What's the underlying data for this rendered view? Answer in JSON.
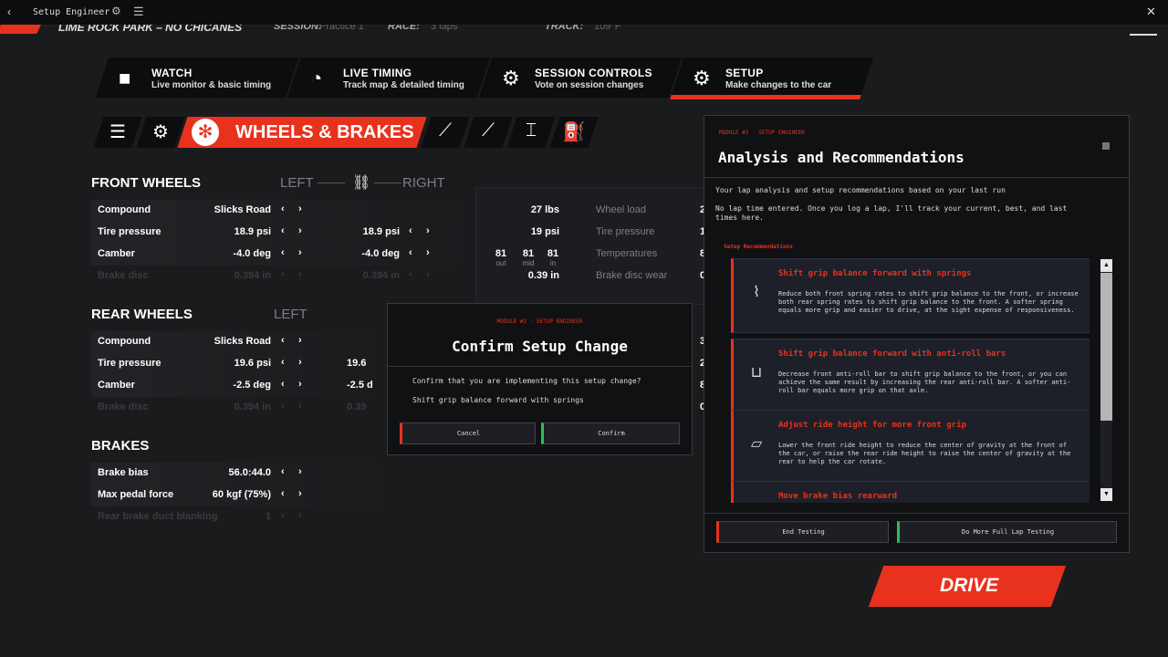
{
  "titlebar": {
    "back": "‹",
    "title": "Setup Engineer",
    "gear": "⚙",
    "menu": "☰",
    "close": "✕"
  },
  "session": {
    "track": "LIME ROCK PARK – NO CHICANES",
    "session_label": "SESSION:",
    "session_value": "Practice 1",
    "race_label": "RACE:",
    "race_value": "3 laps",
    "track_label": "TRACK:",
    "track_value": "109°F"
  },
  "nav": [
    {
      "icon": "■",
      "title": "WATCH",
      "sub": "Live monitor & basic timing"
    },
    {
      "icon": "◔",
      "title": "LIVE TIMING",
      "sub": "Track map & detailed timing"
    },
    {
      "icon": "⚙",
      "title": "SESSION CONTROLS",
      "sub": "Vote on session changes"
    },
    {
      "icon": "⚙",
      "title": "SETUP",
      "sub": "Make changes to the car"
    }
  ],
  "subtabs": {
    "list_icon": "☰",
    "engine_icon": "⚙",
    "active_icon": "✻",
    "active_label": "WHEELS & BRAKES",
    "shock_icon": "⟋",
    "wrench_icon": "⟋",
    "chassis_icon": "⌶",
    "fuel_icon": "⛽"
  },
  "front": {
    "title": "FRONT WHEELS",
    "left": "LEFT",
    "link": "⛓",
    "right": "RIGHT",
    "rows": [
      {
        "label": "Compound",
        "left": "Slicks Road",
        "right": ""
      },
      {
        "label": "Tire pressure",
        "left": "18.9 psi",
        "right": "18.9 psi"
      },
      {
        "label": "Camber",
        "left": "-4.0 deg",
        "right": "-4.0 deg"
      },
      {
        "label": "Brake disc",
        "left": "0.394 in",
        "right": "0.394 in"
      }
    ]
  },
  "rear": {
    "title": "REAR WHEELS",
    "left": "LEFT",
    "rows": [
      {
        "label": "Compound",
        "left": "Slicks Road",
        "right": ""
      },
      {
        "label": "Tire pressure",
        "left": "19.6 psi",
        "right": "19.6"
      },
      {
        "label": "Camber",
        "left": "-2.5 deg",
        "right": "-2.5 d"
      },
      {
        "label": "Brake disc",
        "left": "0.394 in",
        "right": "0.39"
      }
    ]
  },
  "brakes": {
    "title": "BRAKES",
    "rows": [
      {
        "label": "Brake bias",
        "value": "56.0:44.0"
      },
      {
        "label": "Max pedal force",
        "value": "60 kgf (75%)"
      },
      {
        "label": "Rear brake duct blanking",
        "value": "1"
      }
    ]
  },
  "arrows": {
    "left": "‹",
    "right": "›"
  },
  "telemetry": {
    "wheel_load_value": "27 lbs",
    "wheel_load_label": "Wheel load",
    "tire_pressure_value": "19 psi",
    "tire_pressure_label": "Tire pressure",
    "temps": [
      {
        "v": "81",
        "s": "out"
      },
      {
        "v": "81",
        "s": "mid"
      },
      {
        "v": "81",
        "s": "in"
      }
    ],
    "temperatures_label": "Temperatures",
    "disc_wear_value": "0.39 in",
    "disc_wear_label": "Brake disc wear",
    "edge": [
      "2",
      "1",
      "8",
      "0"
    ],
    "edge_rear": [
      "3",
      "2",
      "8",
      "0"
    ]
  },
  "confirm": {
    "crumb": "MODULE #2  ·  SETUP ENGINEER",
    "title": "Confirm Setup Change",
    "body": "Confirm that you are implementing this setup change?",
    "change": "Shift grip balance forward with springs",
    "cancel": "Cancel",
    "confirm": "Confirm"
  },
  "panel": {
    "crumb": "MODULE #2  ·  SETUP ENGINEER",
    "title": "Analysis and Recommendations",
    "intro": "Your lap analysis and setup recommendations based on your last run",
    "nolap": "No lap time entered. Once you log a lap, I'll track your current, best, and last times here.",
    "rec_label": "Setup Recommendations",
    "recs": [
      {
        "icon": "⌇",
        "title": "Shift grip balance forward with springs",
        "desc": "Reduce both front spring rates to shift grip balance to the front, or increase both rear spring rates to shift grip balance to the front. A softer spring equals more grip and easier to drive, at the sight expense of responsiveness."
      },
      {
        "icon": "⊔",
        "title": "Shift grip balance forward with anti-roll bars",
        "desc": "Decrease front anti-roll bar to shift grip balance to the front, or you can achieve the same result by increasing the rear anti-roll bar. A softer anti-roll bar equals more grip on that axle."
      },
      {
        "icon": "▱",
        "title": "Adjust ride height for more front grip",
        "desc": "Lower the front ride height to reduce the center of gravity at the front of the car, or raise the rear ride height to raise the center of gravity at the rear to help the car rotate."
      },
      {
        "icon": "◉",
        "title": "Move brake bias rearward",
        "desc": ""
      }
    ],
    "scroll_up": "▲",
    "scroll_down": "▼",
    "end_testing": "End Testing",
    "more_testing": "Do More Full Lap Testing"
  },
  "drive": "DRIVE"
}
